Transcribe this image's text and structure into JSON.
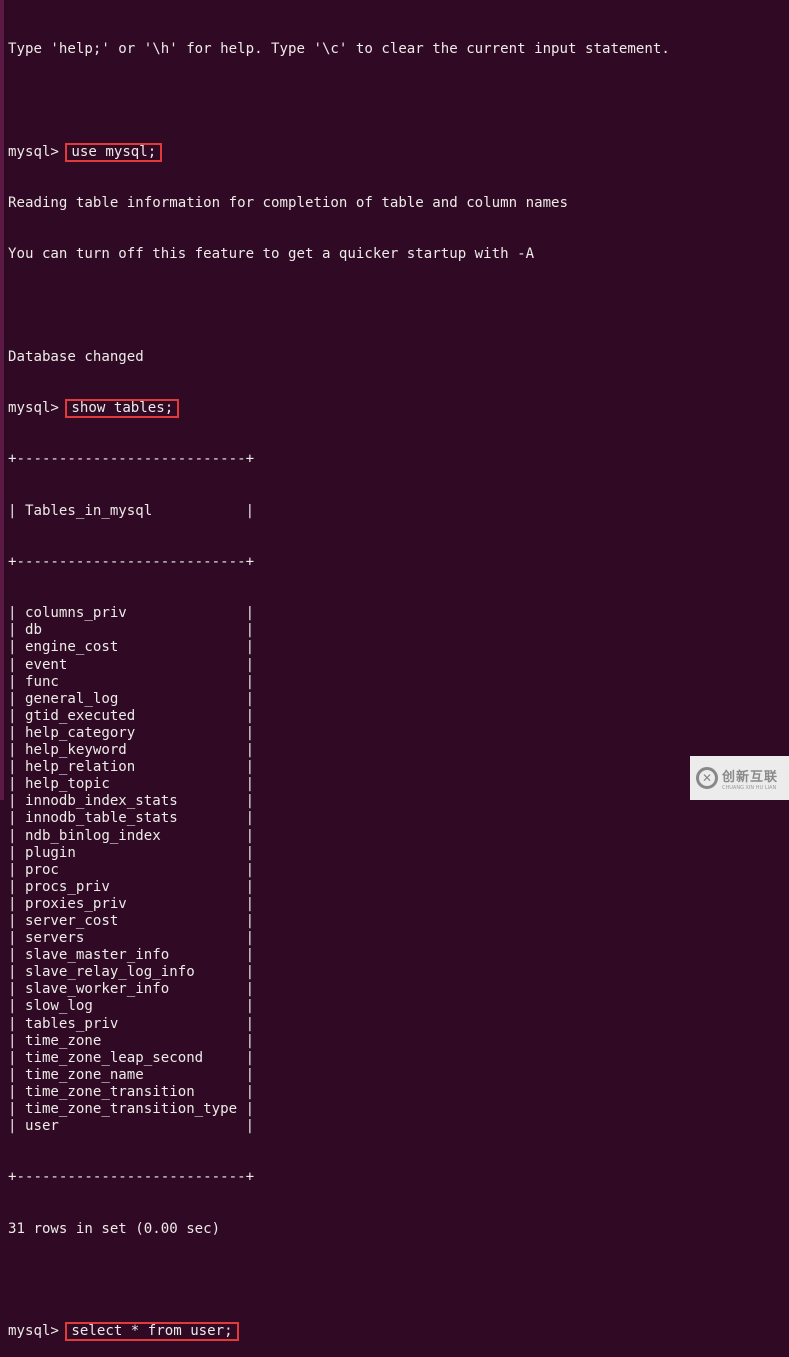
{
  "terminal": {
    "help_line": "Type 'help;' or '\\h' for help. Type '\\c' to clear the current input statement.",
    "prompt": "mysql> ",
    "cmd_use": "use mysql;",
    "reading_line": "Reading table information for completion of table and column names",
    "turnoff_line": "You can turn off this feature to get a quicker startup with -A",
    "db_changed": "Database changed",
    "cmd_show": "show tables;",
    "table_border": "+---------------------------+",
    "table_header": "| Tables_in_mysql           |",
    "rows": [
      "| columns_priv              |",
      "| db                        |",
      "| engine_cost               |",
      "| event                     |",
      "| func                      |",
      "| general_log               |",
      "| gtid_executed             |",
      "| help_category             |",
      "| help_keyword              |",
      "| help_relation             |",
      "| help_topic                |",
      "| innodb_index_stats        |",
      "| innodb_table_stats        |",
      "| ndb_binlog_index          |",
      "| plugin                    |",
      "| proc                      |",
      "| procs_priv                |",
      "| proxies_priv              |",
      "| server_cost               |",
      "| servers                   |",
      "| slave_master_info         |",
      "| slave_relay_log_info      |",
      "| slave_worker_info         |",
      "| slow_log                  |",
      "| tables_priv               |",
      "| time_zone                 |",
      "| time_zone_leap_second     |",
      "| time_zone_name            |",
      "| time_zone_transition      |",
      "| time_zone_transition_type |",
      "| user                      |"
    ],
    "rows_summary": "31 rows in set (0.00 sec)",
    "cmd_select": "select * from user;"
  },
  "watermark": {
    "logo_glyph": "✕",
    "name_cn": "创新互联",
    "name_en": "CHUANG XIN HU LIAN"
  },
  "colors": {
    "background": "#300a24",
    "text": "#ecebe8",
    "highlight_box": "#e03a3a"
  }
}
